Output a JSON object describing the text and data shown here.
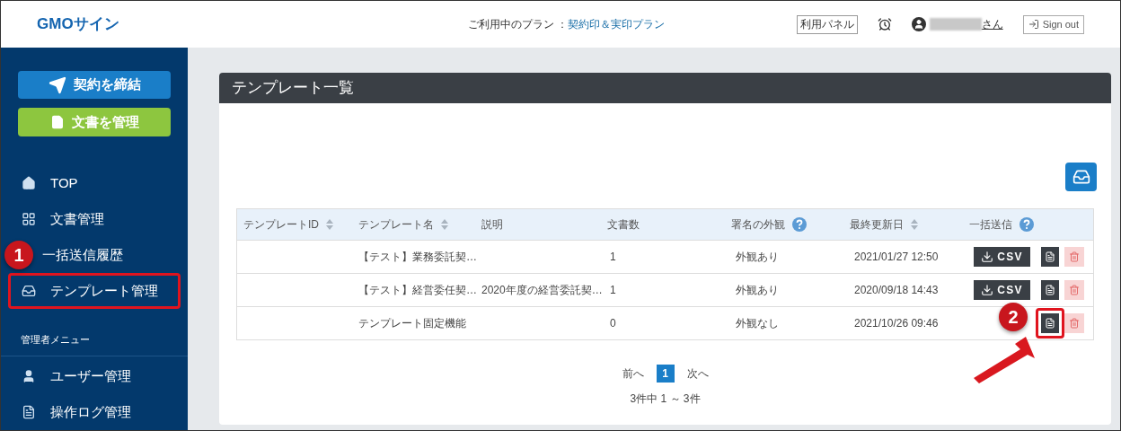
{
  "header": {
    "logo": "GMOサイン",
    "plan_label": "ご利用中のプラン ：",
    "plan_name": "契約印＆実印プラン",
    "panel_button": "利用パネル",
    "user_suffix": "さん",
    "sign_out": "Sign out"
  },
  "sidebar": {
    "actions": [
      {
        "kind": "contract",
        "label": "契約を締結"
      },
      {
        "kind": "documents",
        "label": "文書を管理"
      }
    ],
    "items": [
      {
        "kind": "home",
        "label": "TOP",
        "highlighted": false
      },
      {
        "kind": "grid",
        "label": "文書管理",
        "highlighted": false
      },
      {
        "label": "一括送信履歴",
        "highlighted": false,
        "callout": "1"
      },
      {
        "kind": "inbox",
        "label": "テンプレート管理",
        "highlighted": true
      }
    ],
    "admin_heading": "管理者メニュー",
    "admin_items": [
      {
        "kind": "user",
        "label": "ユーザー管理",
        "highlighted": false
      },
      {
        "kind": "file",
        "label": "操作ログ管理",
        "highlighted": false
      }
    ]
  },
  "panel": {
    "title": "テンプレート一覧",
    "table": {
      "columns": [
        {
          "label": "テンプレートID",
          "kind": "sortable"
        },
        {
          "label": "テンプレート名",
          "kind": "sortable"
        },
        {
          "label": "説明",
          "kind": "plain"
        },
        {
          "label": "文書数",
          "kind": "plain"
        },
        {
          "label": "署名の外観",
          "kind": "help"
        },
        {
          "label": "最終更新日",
          "kind": "sortable"
        },
        {
          "label": "一括送信",
          "kind": "help"
        }
      ],
      "rows": [
        {
          "name": "【テスト】業務委託契…",
          "count": "1",
          "appearance": "外観あり",
          "updated": "2021/01/27 12:50",
          "csv_label": "CSV",
          "highlighted": false
        },
        {
          "name": "【テスト】経営委任契…",
          "description": "2020年度の経営委託契…",
          "count": "1",
          "appearance": "外観あり",
          "updated": "2020/09/18 14:43",
          "csv_label": "CSV",
          "highlighted": false
        },
        {
          "name": "テンプレート固定機能",
          "count": "0",
          "appearance": "外観なし",
          "updated": "2021/10/26 09:46",
          "highlighted": true,
          "callout": "2"
        }
      ]
    },
    "pagination": {
      "prev": "前へ",
      "pages": [
        {
          "label": "1",
          "selected": true
        }
      ],
      "next": "次へ",
      "summary": "3件中 1 ～ 3件"
    }
  }
}
